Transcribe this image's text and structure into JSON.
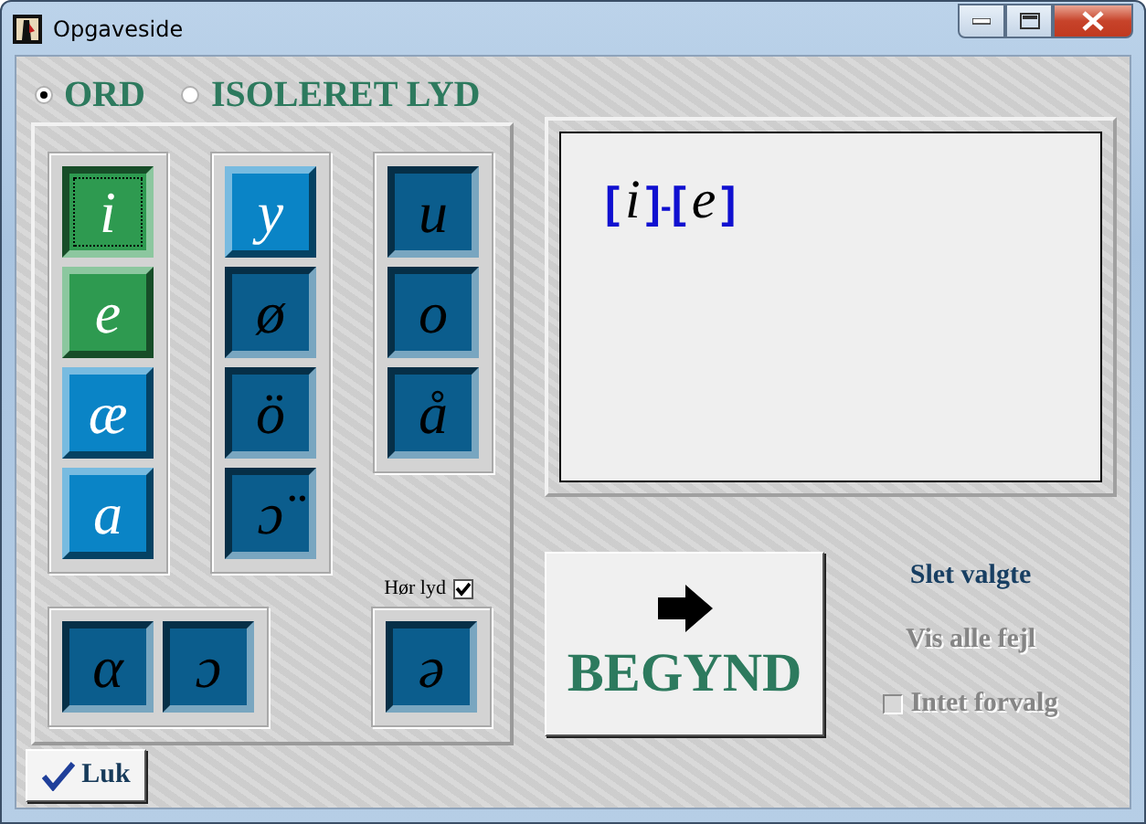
{
  "window": {
    "title": "Opgaveside"
  },
  "modes": [
    {
      "label": "ORD",
      "selected": true
    },
    {
      "label": "ISOLERET LYD",
      "selected": false
    }
  ],
  "top_groups": [
    {
      "sounds": [
        {
          "text": "i",
          "color": "#2e9a50",
          "pressed": true,
          "focused": true
        },
        {
          "text": "e",
          "color": "#2e9a50",
          "pressed": false,
          "focused": false
        },
        {
          "text": "æ",
          "color": "#0a84c6",
          "pressed": false,
          "focused": false
        },
        {
          "text": "a",
          "color": "#0a84c6",
          "pressed": false,
          "focused": false
        }
      ]
    },
    {
      "sounds": [
        {
          "text": "y",
          "color": "#0a84c6",
          "pressed": false,
          "focused": false
        },
        {
          "text": "ø",
          "color": "#0b5d8d",
          "pressed": true,
          "focused": false
        },
        {
          "text": "ö",
          "color": "#0b5d8d",
          "pressed": true,
          "focused": false
        },
        {
          "text": "ɔ̈",
          "color": "#0b5d8d",
          "pressed": true,
          "focused": false
        }
      ]
    },
    {
      "sounds": [
        {
          "text": "u",
          "color": "#0b5d8d",
          "pressed": true,
          "focused": false
        },
        {
          "text": "o",
          "color": "#0b5d8d",
          "pressed": true,
          "focused": false
        },
        {
          "text": "å",
          "color": "#0b5d8d",
          "pressed": true,
          "focused": false
        }
      ]
    }
  ],
  "hear_sound": {
    "label": "Hør lyd",
    "checked": true
  },
  "bottom_groups": [
    {
      "sounds": [
        {
          "text": "α",
          "color": "#0b5d8d",
          "pressed": true,
          "focused": false
        },
        {
          "text": "ɔ",
          "color": "#0b5d8d",
          "pressed": true,
          "focused": false
        }
      ]
    },
    {
      "sounds": [
        {
          "text": "ə",
          "color": "#0b5d8d",
          "pressed": true,
          "focused": false
        }
      ]
    }
  ],
  "display": {
    "parts": [
      {
        "kind": "bracket",
        "text": "["
      },
      {
        "kind": "sound",
        "text": "i"
      },
      {
        "kind": "bracket",
        "text": "]"
      },
      {
        "kind": "separator",
        "text": "-"
      },
      {
        "kind": "bracket",
        "text": "["
      },
      {
        "kind": "sound",
        "text": "e"
      },
      {
        "kind": "bracket",
        "text": "]"
      }
    ]
  },
  "start_button": {
    "label": "BEGYND"
  },
  "actions": [
    {
      "label": "Slet valgte",
      "disabled": false
    },
    {
      "label": "Vis alle fejl",
      "disabled": true
    }
  ],
  "no_preselect": {
    "label": "Intet forvalg",
    "checked": false,
    "disabled": true
  },
  "close_button": {
    "label": "Luk"
  }
}
